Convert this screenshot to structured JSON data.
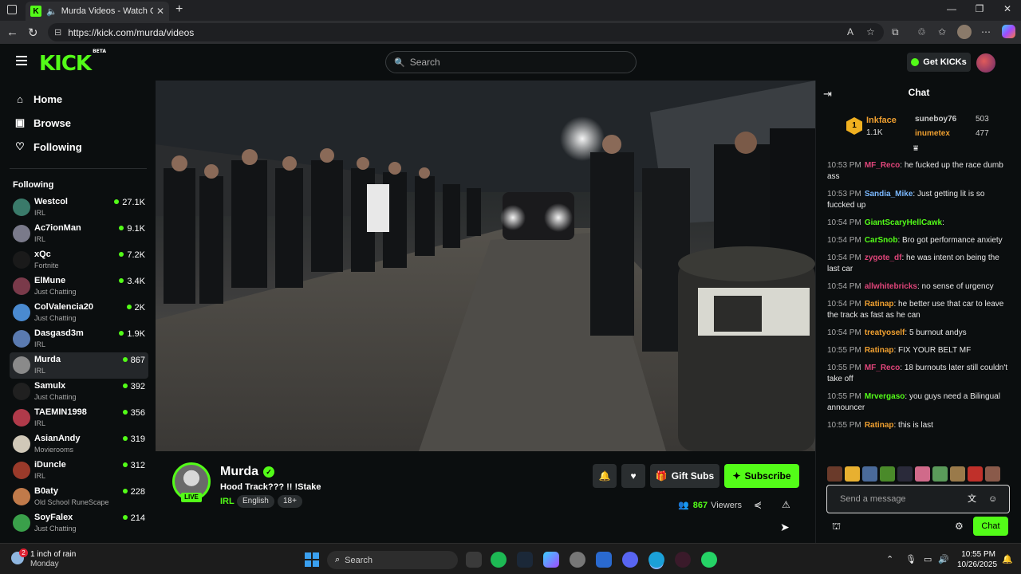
{
  "browser": {
    "tab_title": "Murda Videos - Watch On-D",
    "url": "https://kick.com/murda/videos",
    "tab_close": "✕",
    "new_tab": "+"
  },
  "header": {
    "logo": "KICK",
    "logo_badge": "BETA",
    "search_placeholder": "Search",
    "get_kicks": "Get KICKs"
  },
  "sidebar": {
    "nav": [
      {
        "label": "Home",
        "icon": "home-icon"
      },
      {
        "label": "Browse",
        "icon": "browse-icon"
      },
      {
        "label": "Following",
        "icon": "heart-icon"
      }
    ],
    "following_heading": "Following",
    "following": [
      {
        "name": "Westcol",
        "category": "IRL",
        "viewers": "27.1K",
        "color": "#3a7a6a"
      },
      {
        "name": "Ac7ionMan",
        "category": "IRL",
        "viewers": "9.1K",
        "color": "#7a7a8a"
      },
      {
        "name": "xQc",
        "category": "Fortnite",
        "viewers": "7.2K",
        "color": "#1a1a1a"
      },
      {
        "name": "ElMune",
        "category": "Just Chatting",
        "viewers": "3.4K",
        "color": "#7a3a4a"
      },
      {
        "name": "ColValencia20",
        "category": "Just Chatting",
        "viewers": "2K",
        "color": "#4a8ad0"
      },
      {
        "name": "Dasgasd3m",
        "category": "IRL",
        "viewers": "1.9K",
        "color": "#5a7ab0"
      },
      {
        "name": "Murda",
        "category": "IRL",
        "viewers": "867",
        "color": "#8a8a8a"
      },
      {
        "name": "Samulx",
        "category": "Just Chatting",
        "viewers": "392",
        "color": "#202020"
      },
      {
        "name": "TAEMIN1998",
        "category": "IRL",
        "viewers": "356",
        "color": "#b03a4a"
      },
      {
        "name": "AsianAndy",
        "category": "Movierooms",
        "viewers": "319",
        "color": "#d0c8b8"
      },
      {
        "name": "iDuncle",
        "category": "IRL",
        "viewers": "312",
        "color": "#9a3a2a"
      },
      {
        "name": "B0aty",
        "category": "Old School RuneScape",
        "viewers": "228",
        "color": "#c07a4a"
      },
      {
        "name": "SoyFalex",
        "category": "Just Chatting",
        "viewers": "214",
        "color": "#3aa04a"
      }
    ],
    "active_index": 6
  },
  "stream": {
    "name": "Murda",
    "title": "Hood Track??? !! !Stake",
    "category": "IRL",
    "tags": [
      "English",
      "18+"
    ],
    "live_label": "LIVE",
    "gift_subs": "Gift Subs",
    "subscribe": "Subscribe",
    "viewer_count": "867",
    "viewers_label": "Viewers"
  },
  "chat": {
    "title": "Chat",
    "pinned": {
      "top_name": "Inkface",
      "top_count": "1.1K",
      "second_name": "suneboy76",
      "second_count": "503",
      "third_name": "inumetex",
      "third_count": "477"
    },
    "messages": [
      {
        "time": "10:53 PM",
        "user": "MF_Reco",
        "color": "#e0457a",
        "text": "he fucked up the race dumb ass"
      },
      {
        "time": "10:53 PM",
        "user": "Sandia_Mike",
        "color": "#7ab8ff",
        "text": "Just getting lit is so fuccked up"
      },
      {
        "time": "10:54 PM",
        "user": "GiantScaryHellCawk",
        "color": "#53fc18",
        "text": ""
      },
      {
        "time": "10:54 PM",
        "user": "CarSnob",
        "color": "#53fc18",
        "text": "Bro got performance anxiety"
      },
      {
        "time": "10:54 PM",
        "user": "zygote_df",
        "color": "#e0457a",
        "text": "he was intent on being the last car"
      },
      {
        "time": "10:54 PM",
        "user": "allwhitebricks",
        "color": "#e0457a",
        "text": "no sense of urgency"
      },
      {
        "time": "10:54 PM",
        "user": "Ratinap",
        "color": "#f0a030",
        "text": "he better use that car to leave the track as fast as he can"
      },
      {
        "time": "10:54 PM",
        "user": "treatyoself",
        "color": "#f0a030",
        "text": "5 burnout andys"
      },
      {
        "time": "10:55 PM",
        "user": "Ratinap",
        "color": "#f0a030",
        "text": "FIX YOUR BELT MF"
      },
      {
        "time": "10:55 PM",
        "user": "MF_Reco",
        "color": "#e0457a",
        "text": "18 burnouts later still couldn't take off"
      },
      {
        "time": "10:55 PM",
        "user": "Mrvergaso",
        "color": "#53fc18",
        "text": "you guys need a Bilingual announcer"
      },
      {
        "time": "10:55 PM",
        "user": "Ratinap",
        "color": "#f0a030",
        "text": "this is last"
      }
    ],
    "input_placeholder": "Send a message",
    "send_label": "Chat"
  },
  "taskbar": {
    "weather_line1": "1 inch of rain",
    "weather_line2": "Monday",
    "weather_badge": "2",
    "search_placeholder": "Search",
    "time": "10:55 PM",
    "date": "10/26/2025"
  }
}
